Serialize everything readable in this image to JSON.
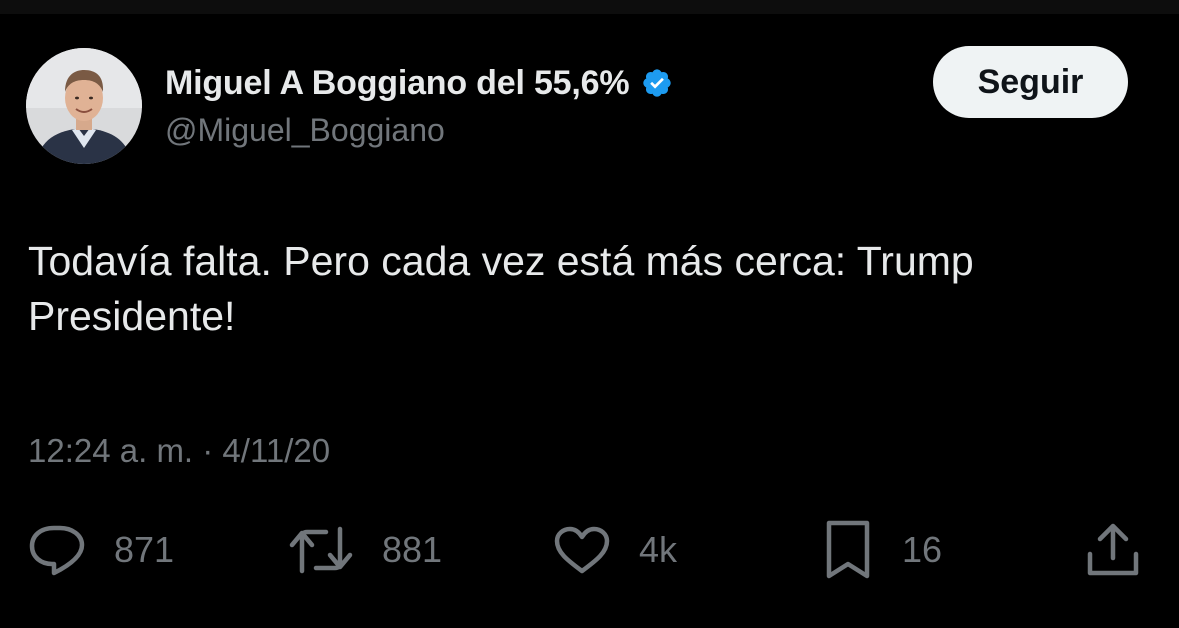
{
  "author": {
    "display_name": "Miguel A Boggiano del 55,6%",
    "handle": "@Miguel_Boggiano",
    "avatar_icon": "profile-photo",
    "verified_icon": "verified-badge-icon"
  },
  "follow_button": {
    "label": "Seguir"
  },
  "tweet": {
    "text": "Todavía falta. Pero cada vez está más cerca: Trump\nPresidente!",
    "timestamp": "12:24 a. m. · 4/11/20"
  },
  "actions": {
    "reply": {
      "icon": "reply-icon",
      "count": "871"
    },
    "retweet": {
      "icon": "retweet-icon",
      "count": "881"
    },
    "like": {
      "icon": "heart-icon",
      "count": "4k"
    },
    "bookmark": {
      "icon": "bookmark-icon",
      "count": "16"
    },
    "share": {
      "icon": "share-icon"
    }
  },
  "colors": {
    "background": "#000000",
    "text_primary": "#e7e9ea",
    "text_secondary": "#71767b",
    "verified_blue": "#1d9bf0",
    "button_bg": "#eff3f4",
    "button_text": "#0f1419"
  }
}
